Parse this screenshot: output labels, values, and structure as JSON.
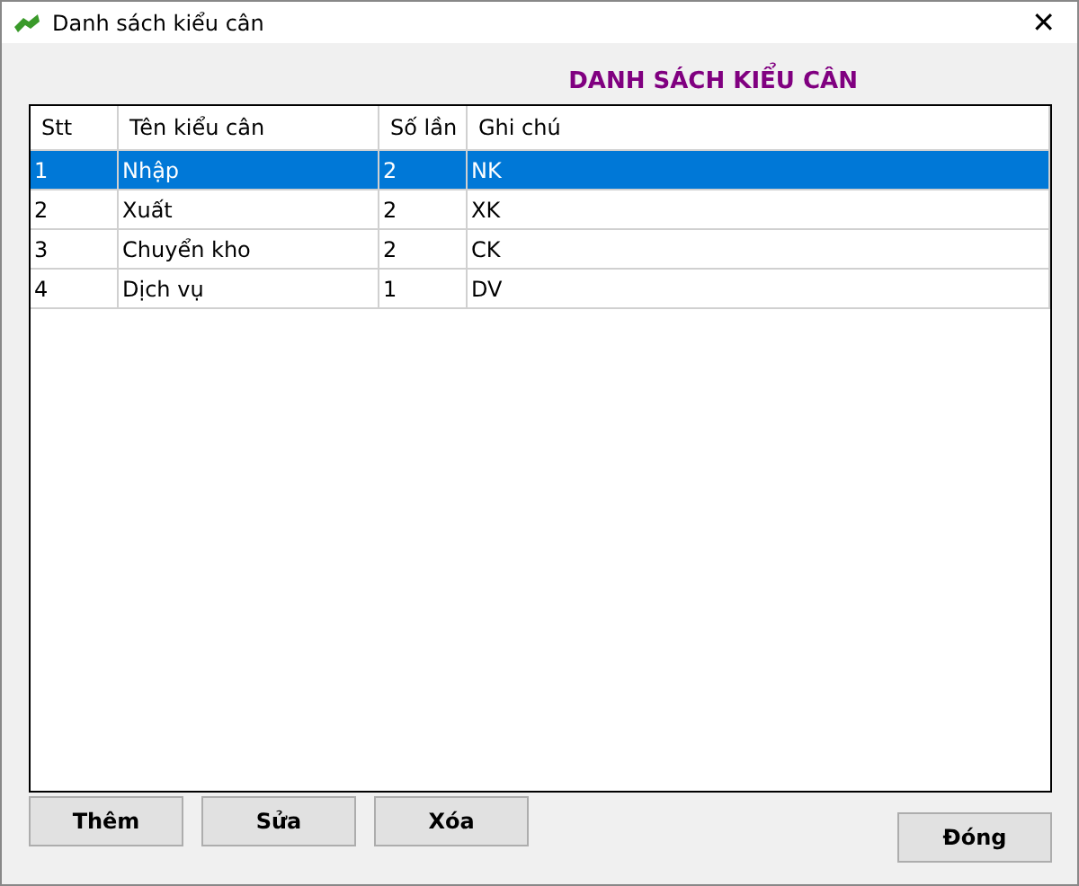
{
  "window": {
    "title": "Danh sách kiểu cân",
    "close": "✕"
  },
  "heading": "DANH SÁCH KIỂU CÂN",
  "table": {
    "columns": [
      "Stt",
      "Tên kiểu cân",
      "Số lần",
      "Ghi chú"
    ],
    "rows": [
      {
        "cells": [
          "1",
          "Nhập",
          "2",
          "NK"
        ],
        "selected": true
      },
      {
        "cells": [
          "2",
          "Xuất",
          "2",
          "XK"
        ],
        "selected": false
      },
      {
        "cells": [
          "3",
          "Chuyển kho",
          "2",
          "CK"
        ],
        "selected": false
      },
      {
        "cells": [
          "4",
          "Dịch vụ",
          "1",
          "DV"
        ],
        "selected": false
      }
    ]
  },
  "buttons": [
    "Thêm",
    "Sửa",
    "Xóa"
  ],
  "close_button": "Đóng"
}
